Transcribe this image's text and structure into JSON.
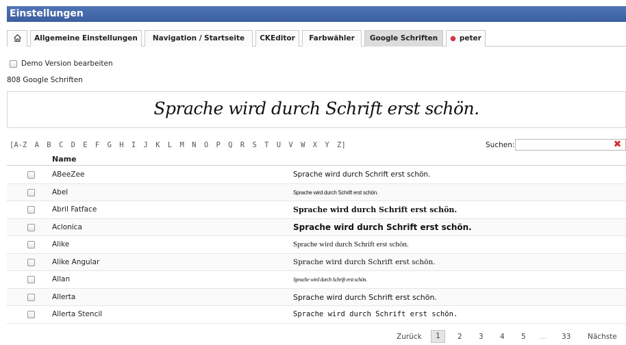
{
  "window": {
    "title": "Einstellungen"
  },
  "tabs": [
    {
      "label": "Allgemeine Einstellungen"
    },
    {
      "label": "Navigation / Startseite"
    },
    {
      "label": "CKEditor"
    },
    {
      "label": "Farbwähler"
    },
    {
      "label": "Google Schriften"
    },
    {
      "label": "peter"
    }
  ],
  "demo": {
    "label": "Demo Version bearbeiten",
    "checked": false
  },
  "count_text": "808 Google Schriften",
  "preview": {
    "text": "Sprache wird durch Schrift erst schön."
  },
  "alphabet": [
    "[A-Z",
    "A",
    "B",
    "C",
    "D",
    "E",
    "F",
    "G",
    "H",
    "I",
    "J",
    "K",
    "L",
    "M",
    "N",
    "O",
    "P",
    "Q",
    "R",
    "S",
    "T",
    "U",
    "V",
    "W",
    "X",
    "Y",
    "Z]"
  ],
  "search": {
    "label": "Suchen:",
    "value": ""
  },
  "table": {
    "header": "Name",
    "rows": [
      {
        "name": "ABeeZee",
        "sample": "Sprache wird durch Schrift erst schön."
      },
      {
        "name": "Abel",
        "sample": "Sprache wird durch Schrift erst schön."
      },
      {
        "name": "Abril Fatface",
        "sample": "Sprache wird durch Schrift erst schön."
      },
      {
        "name": "Aclonica",
        "sample": "Sprache wird durch Schrift erst schön."
      },
      {
        "name": "Alike",
        "sample": "Sprache wird durch Schrift erst schön."
      },
      {
        "name": "Alike Angular",
        "sample": "Sprache wird durch Schrift erst schön."
      },
      {
        "name": "Allan",
        "sample": "Sprache wird durch Schrift erst schön."
      },
      {
        "name": "Allerta",
        "sample": "Sprache wird durch Schrift erst schön."
      },
      {
        "name": "Allerta Stencil",
        "sample": "Sprache wird durch Schrift erst schön."
      }
    ]
  },
  "pagination": {
    "prev": "Zurück",
    "pages": [
      "1",
      "2",
      "3",
      "4",
      "5"
    ],
    "ellipsis": "...",
    "last": "33",
    "next": "Nächste",
    "current": "1"
  },
  "icons": {
    "home": "home-icon",
    "user": "user-icon",
    "clear": "clear-search-icon"
  }
}
